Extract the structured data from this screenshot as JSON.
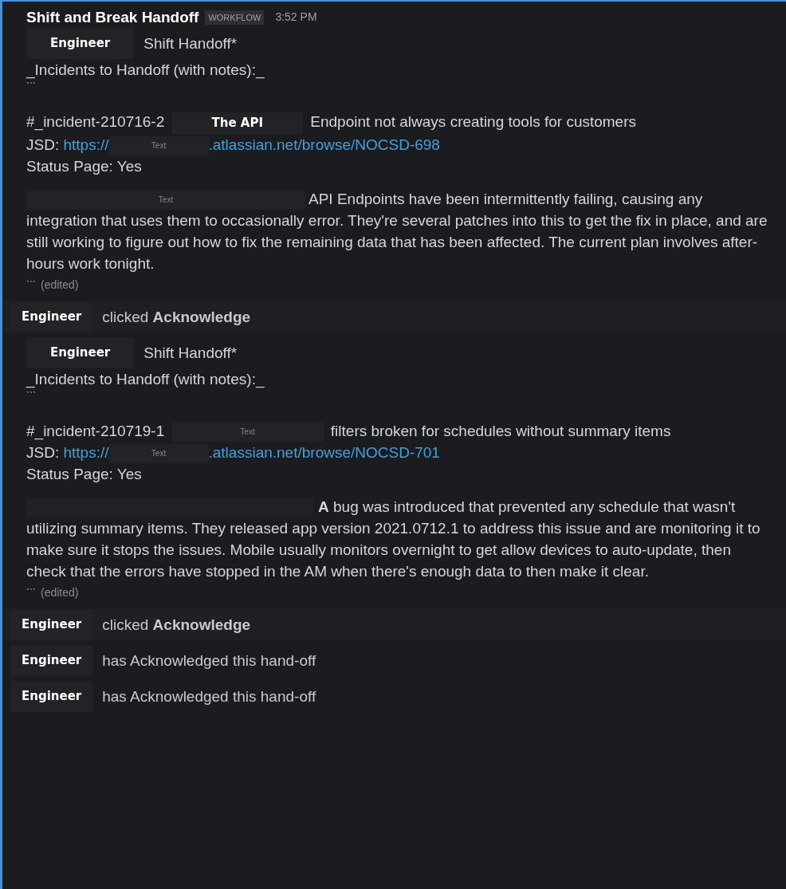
{
  "header": {
    "title": "Shift and Break Handoff",
    "badge": "WORKFLOW",
    "time": "3:52 PM"
  },
  "messages": [
    {
      "kind": "handoff",
      "author": "Engineer",
      "title": "Shift Handoff*",
      "heading": "_Incidents to Handoff (with notes):_",
      "fence_open": "```",
      "incident": {
        "id": "#_incident-210716-2",
        "tag": "The API",
        "summary": "Endpoint not always creating tools for customers"
      },
      "jsd": {
        "label": "JSD:",
        "link_start": "https://",
        "redacted": "Text",
        "link_end": ".atlassian.net/browse/NOCSD-698"
      },
      "status": "Status Page: Yes",
      "notes": {
        "redacted": "Text",
        "text": "API Endpoints have been intermittently failing, causing any integration that uses them to occasionally error.   They're several patches into this to get the fix in place, and are still working to figure out how to fix the remaining data that has been affected.  The current plan involves after-hours work tonight."
      },
      "fence_close": "```",
      "edited": "(edited)"
    },
    {
      "kind": "action",
      "author": "Engineer",
      "text": "clicked **Acknowledge**"
    },
    {
      "kind": "handoff",
      "author": "Engineer",
      "title": "Shift Handoff*",
      "heading": "_Incidents to Handoff (with notes):_",
      "fence_open": "```",
      "incident": {
        "id": "#_incident-210719-1",
        "redacted": "Text",
        "summary": "filters broken for schedules without summary items"
      },
      "jsd": {
        "label": "JSD:",
        "link_start": "https://",
        "redacted": "Text",
        "link_end": ".atlassian.net/browse/NOCSD-701"
      },
      "status": "Status Page: Yes",
      "notes": {
        "text": "**A** bug was introduced that prevented any schedule that wasn't utilizing summary items.  They released app version 2021.0712.1 to address this issue and are monitoring it to make sure it stops the issues.  Mobile usually monitors overnight to get allow devices to auto-update, then check that the errors have stopped in the AM when there's enough data to then make it clear."
      },
      "fence_close": "```",
      "edited": "(edited)"
    },
    {
      "kind": "action",
      "author": "Engineer",
      "text": "clicked **Acknowledge**"
    },
    {
      "kind": "status",
      "author": "Engineer",
      "text": "has Acknowledged this hand-off"
    },
    {
      "kind": "status",
      "author": "Engineer",
      "text": "has Acknowledged this hand-off"
    }
  ]
}
